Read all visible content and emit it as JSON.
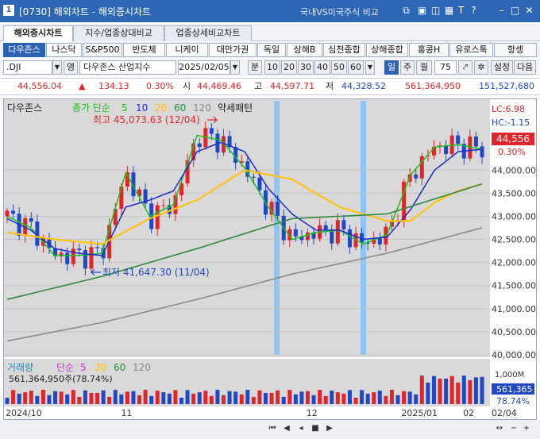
{
  "window": {
    "number": "1",
    "title": "[0730] 해외차트 - 해외증시차트",
    "right_link": "국내VS미국주식 비교",
    "icons": [
      "window-icon",
      "lock-icon",
      "chart-icon",
      "grid-icon",
      "text-icon",
      "help-icon",
      "minimize-icon",
      "maximize-icon",
      "close-icon"
    ]
  },
  "tabs": [
    "해외증시차트",
    "지수/업종상대비교",
    "업종상세비교차트"
  ],
  "categories": [
    "다우존스",
    "나스닥",
    "S&P500",
    "반도체",
    "니케이",
    "대만가권",
    "독일",
    "상해B",
    "심천종합",
    "상해종합",
    "홍콩H",
    "유로스톡",
    "항셍"
  ],
  "controls": {
    "code": ".DJI",
    "eng_label": "영",
    "name": "다우존스 산업지수",
    "date": "2025/02/05",
    "minute_label": "분",
    "intervals": [
      "10",
      "20",
      "30",
      "40",
      "50",
      "60"
    ],
    "period_day": "일",
    "period_week": "주",
    "period_month": "월",
    "count": "75",
    "settings": "설정",
    "next": "다음"
  },
  "quote": {
    "price": "44,556.04",
    "arrow": "▲",
    "change": "134.13",
    "change_pct": "0.30%",
    "open_label": "시",
    "open": "44,469.46",
    "high_label": "고",
    "high": "44,597.71",
    "low_label": "저",
    "low": "44,328.52",
    "volume": "561,364,950",
    "amount": "151,527,680"
  },
  "chart_meta": {
    "legend_name": "다우존스",
    "legend_ma": "종가 단순",
    "legend_ma_periods": [
      "5",
      "10",
      "20",
      "60",
      "120"
    ],
    "legend_pattern": "약세패턴",
    "high_label": "최고 45,073.63 (12/04)",
    "low_label": "최저 41,647.30 (11/04)",
    "lc_label": "LC:6.98",
    "hc_label": "HC:-1.15",
    "current_price_tag": "44,556",
    "current_pct_tag": "0.30%",
    "vol_legend_name": "거래량",
    "vol_legend_ma": "단순",
    "vol_legend_periods": [
      "5",
      "20",
      "60",
      "120"
    ],
    "vol_info": "561,364,950주(78.74%)",
    "vol_axis_label": "1,000M",
    "vol_tag": "561,365",
    "vol_pct_tag": "78.74%",
    "x_left": "2024/10",
    "x_right": "02/04",
    "colors": {
      "up": "#e0262b",
      "down": "#1f47c6",
      "ma5": "#19c319",
      "ma10": "#1c2bd1",
      "ma20": "#ffc20d",
      "ma60": "#2e8b3e",
      "ma120": "#8a8a8a",
      "highlight": "#8cc4f7"
    }
  },
  "chart_data": {
    "type": "line",
    "title": "",
    "xlabel": "",
    "ylabel": "",
    "ylim": [
      40000,
      45500
    ],
    "yticks": [
      40000,
      40500,
      41000,
      41500,
      42000,
      42500,
      43000,
      43500,
      44000
    ],
    "xticks": [
      "2024/10",
      "11",
      "12",
      "2025/01",
      "02"
    ],
    "series": [
      {
        "name": "5",
        "x": [
          0,
          5,
          10,
          15,
          20,
          25,
          30,
          35,
          40,
          45,
          50,
          55,
          60,
          65,
          70,
          75,
          80,
          85,
          90,
          95,
          100
        ],
        "values": [
          43000,
          42750,
          42150,
          42150,
          42200,
          43950,
          43000,
          43250,
          44750,
          44650,
          44050,
          43200,
          42500,
          42650,
          42700,
          42400,
          42600,
          43900,
          44500,
          44550,
          44450
        ]
      },
      {
        "name": "10",
        "x": [
          0,
          5,
          10,
          15,
          20,
          25,
          30,
          35,
          40,
          45,
          50,
          55,
          60,
          65,
          70,
          75,
          80,
          85,
          90,
          95,
          100
        ],
        "values": [
          42950,
          42700,
          42300,
          42200,
          42150,
          43200,
          43350,
          43550,
          44400,
          44600,
          44400,
          43600,
          43050,
          42700,
          42700,
          42500,
          42550,
          43150,
          44000,
          44400,
          44450
        ]
      },
      {
        "name": "20",
        "x": [
          0,
          10,
          20,
          30,
          40,
          50,
          60,
          70,
          80,
          85,
          90,
          95,
          100
        ],
        "values": [
          42650,
          42500,
          42400,
          42950,
          43350,
          44000,
          43800,
          43200,
          42900,
          42900,
          43300,
          43550,
          43700
        ]
      },
      {
        "name": "60",
        "x": [
          0,
          20,
          40,
          60,
          80,
          100
        ],
        "values": [
          41200,
          41700,
          42300,
          42950,
          43050,
          43700
        ]
      },
      {
        "name": "120",
        "x": [
          0,
          20,
          40,
          60,
          80,
          100
        ],
        "values": [
          40300,
          40700,
          41200,
          41750,
          42200,
          42750
        ]
      }
    ]
  }
}
